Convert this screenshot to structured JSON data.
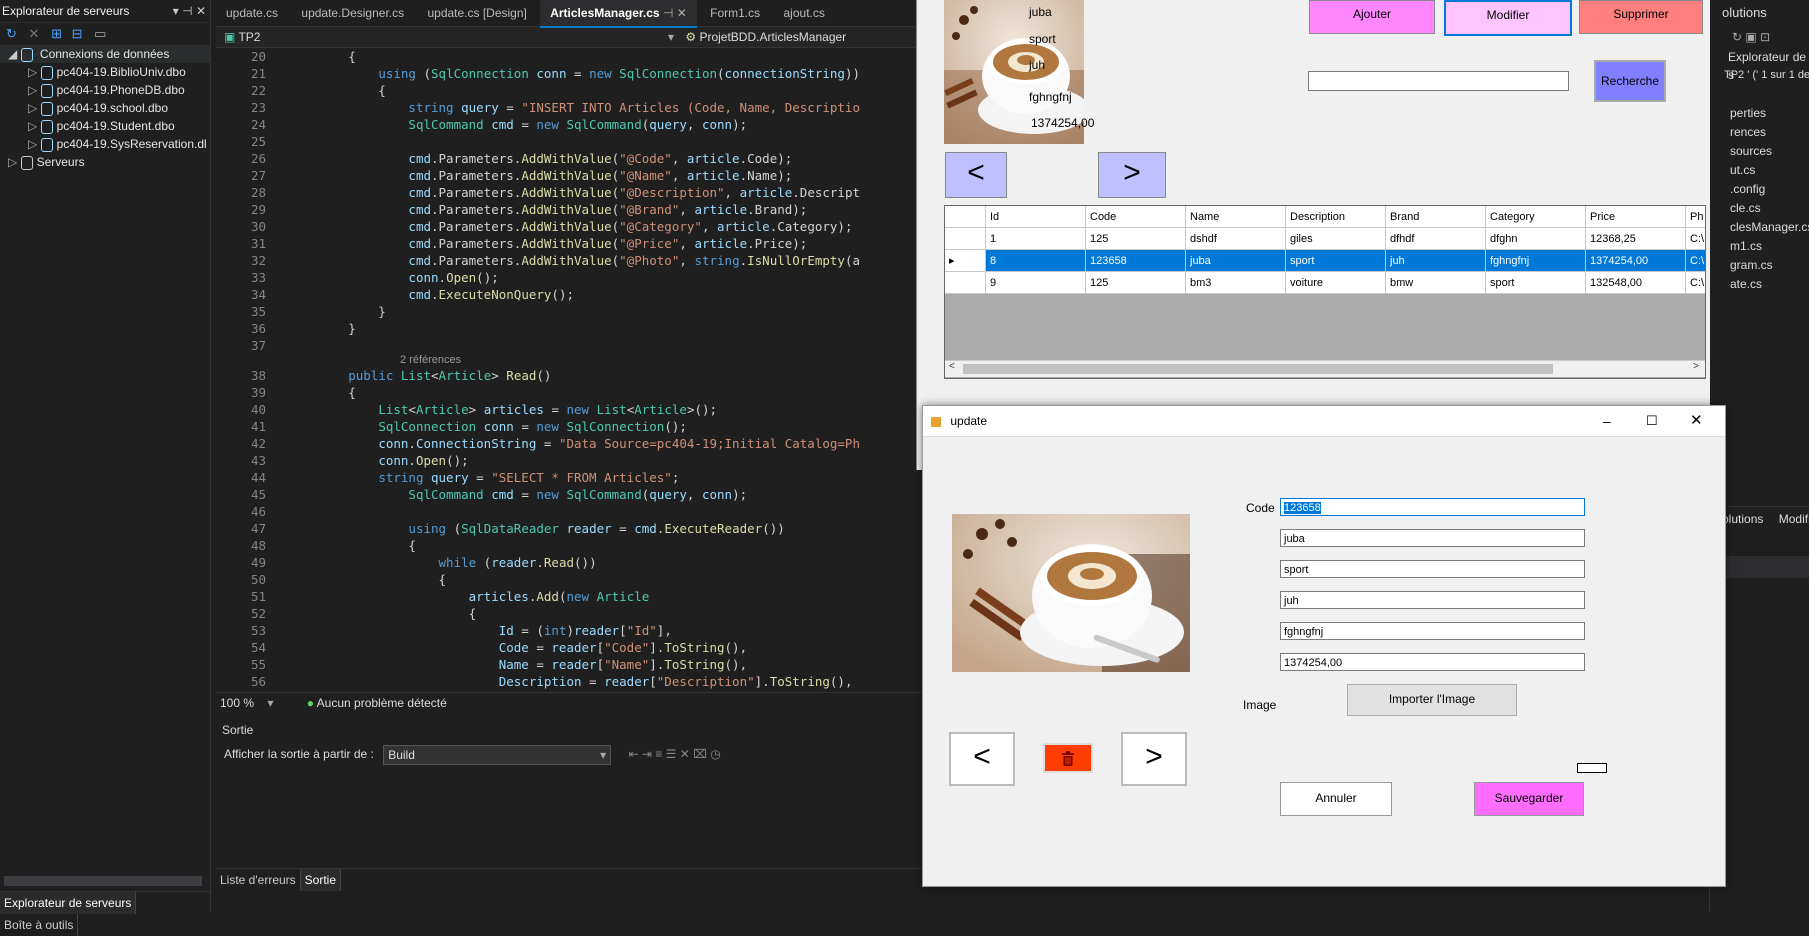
{
  "server_explorer": {
    "title": "Explorateur de serveurs",
    "root": "Connexions de données",
    "connections": [
      "pc404-19.BiblioUniv.dbo",
      "pc404-19.PhoneDB.dbo",
      "pc404-19.school.dbo",
      "pc404-19.Student.dbo",
      "pc404-19.SysReservation.dl"
    ],
    "servers": "Serveurs",
    "bottom_tabs": [
      "Explorateur de serveurs",
      "Boîte à outils"
    ]
  },
  "editor": {
    "tabs": [
      "update.cs",
      "update.Designer.cs",
      "update.cs [Design]",
      "ArticlesManager.cs",
      "Form1.cs",
      "ajout.cs"
    ],
    "active_tab": "ArticlesManager.cs",
    "project": "TP2",
    "class_path": "ProjetBDD.ArticlesManager",
    "references": "2 références",
    "zoom": "100 %",
    "status": "Aucun problème détecté",
    "line_numbers": [
      "20",
      "21",
      "22",
      "23",
      "24",
      "25",
      "26",
      "27",
      "28",
      "29",
      "30",
      "31",
      "32",
      "33",
      "34",
      "35",
      "36",
      "37",
      "38",
      "39",
      "40",
      "41",
      "42",
      "43",
      "44",
      "45",
      "46",
      "47",
      "48",
      "49",
      "50",
      "51",
      "52",
      "53",
      "54",
      "55",
      "56"
    ]
  },
  "output": {
    "title": "Sortie",
    "source_label": "Afficher la sortie à partir de :",
    "source_value": "Build",
    "bottom_tabs": [
      "Liste d'erreurs",
      "Sortie"
    ]
  },
  "main_form": {
    "info": [
      "juba",
      "sport",
      "juh",
      "fghngfnj",
      "1374254,00"
    ],
    "buttons": {
      "add": "Ajouter",
      "modify": "Modifier",
      "delete": "Supprimer",
      "search": "Recherche"
    },
    "prev": "<",
    "next": ">",
    "grid": {
      "headers": [
        "Id",
        "Code",
        "Name",
        "Description",
        "Brand",
        "Category",
        "Price",
        "Ph"
      ],
      "rows": [
        [
          "1",
          "125",
          "dshdf",
          "giles",
          "dfhdf",
          "dfghn",
          "12368,25",
          "C:\\"
        ],
        [
          "8",
          "123658",
          "juba",
          "sport",
          "juh",
          "fghngfnj",
          "1374254,00",
          "C:\\"
        ],
        [
          "9",
          "125",
          "bm3",
          "voiture",
          "bmw",
          "sport",
          "132548,00",
          "C:\\"
        ]
      ]
    }
  },
  "dialog": {
    "title": "update",
    "code_label": "Code",
    "fields": [
      "123658",
      "juba",
      "sport",
      "juh",
      "fghngfnj",
      "1374254,00"
    ],
    "image_label": "Image",
    "import_button": "Importer l'Image",
    "prev": "<",
    "next": ">",
    "cancel": "Annuler",
    "save": "Sauvegarder"
  },
  "solution_explorer": {
    "header": "olutions",
    "subheader": "Explorateur de s",
    "tp_line": "TP2 ' (' 1 sur 1 de",
    "items": [
      "perties",
      "rences",
      "sources",
      "ut.cs",
      ".config",
      "cle.cs",
      "clesManager.cs",
      "m1.cs",
      "gram.cs",
      "ate.cs"
    ],
    "bottom": [
      "olutions",
      "Modifi"
    ]
  }
}
